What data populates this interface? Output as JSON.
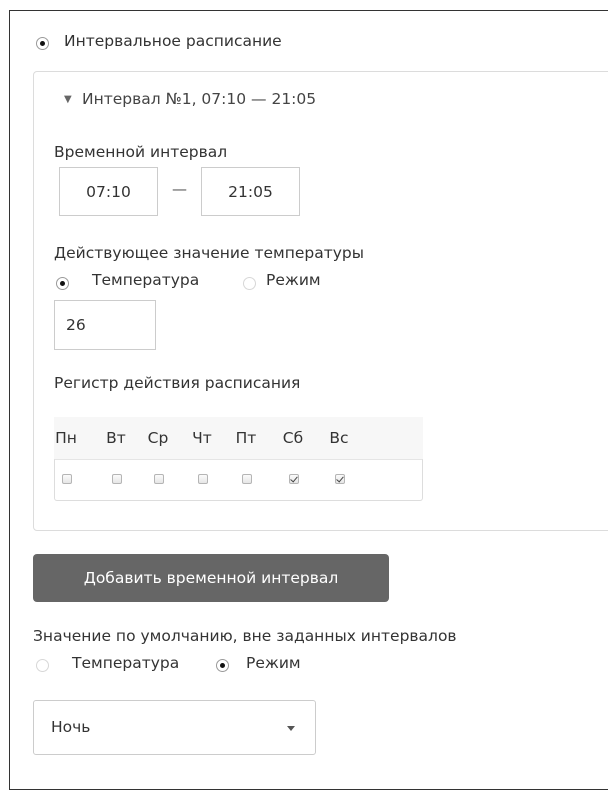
{
  "schedule_mode": {
    "label": "Интервальное расписание",
    "selected": true
  },
  "interval": {
    "header": "Интервал №1, 07:10 — 21:05",
    "time_label": "Временной интервал",
    "start": "07:10",
    "separator": "—",
    "end": "21:05",
    "value_label": "Действующее значение температуры",
    "option_temperature": "Температура",
    "option_mode": "Режим",
    "selected_option": "Температура",
    "temperature_value": "26",
    "days_label": "Регистр действия расписания",
    "days": [
      {
        "label": "Пн",
        "checked": false
      },
      {
        "label": "Вт",
        "checked": false
      },
      {
        "label": "Ср",
        "checked": false
      },
      {
        "label": "Чт",
        "checked": false
      },
      {
        "label": "Пт",
        "checked": false
      },
      {
        "label": "Сб",
        "checked": true
      },
      {
        "label": "Вс",
        "checked": true
      }
    ]
  },
  "add_interval_button": "Добавить временной интервал",
  "default_value": {
    "label": "Значение по умолчанию, вне заданных интервалов",
    "option_temperature": "Температура",
    "option_mode": "Режим",
    "selected_option": "Режим",
    "select_value": "Ночь"
  }
}
